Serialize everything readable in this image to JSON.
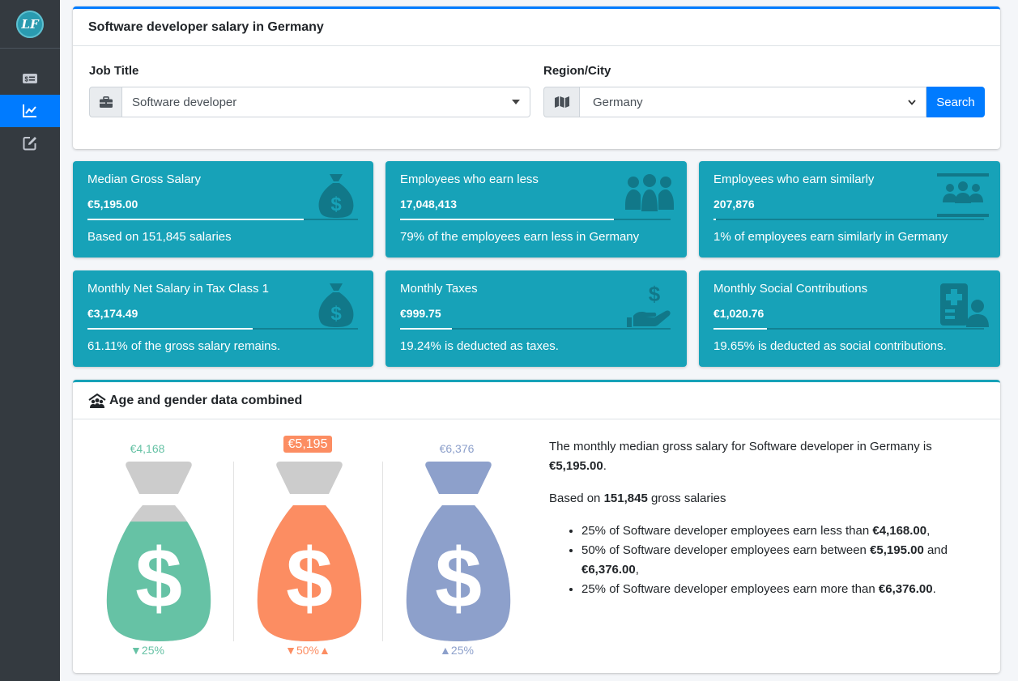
{
  "sidebar": {
    "logo": "LF",
    "items": [
      {
        "icon": "money-bill-icon"
      },
      {
        "icon": "chart-line-icon",
        "active": true
      },
      {
        "icon": "edit-icon"
      }
    ]
  },
  "search": {
    "title": "Software developer salary in Germany",
    "job_label": "Job Title",
    "job_value": "Software developer",
    "region_label": "Region/City",
    "region_value": "Germany",
    "search_button": "Search"
  },
  "info_boxes": [
    {
      "title": "Median Gross Salary",
      "number": "€5,195.00",
      "desc": "Based on 151,845 salaries",
      "progress": 0.8,
      "icon": "money-bag-icon"
    },
    {
      "title": "Employees who earn less",
      "number": "17,048,413",
      "desc": "79% of the employees earn less in Germany",
      "progress": 0.79,
      "icon": "people-group-icon"
    },
    {
      "title": "Employees who earn similarly",
      "number": "207,876",
      "desc": "1% of employees earn similarly in Germany",
      "progress": 0.01,
      "icon": "people-line-icon"
    },
    {
      "title": "Monthly Net Salary in Tax Class 1",
      "number": "€3,174.49",
      "desc": "61.11% of the gross salary remains.",
      "progress": 0.6111,
      "icon": "money-bag-icon"
    },
    {
      "title": "Monthly Taxes",
      "number": "€999.75",
      "desc": "19.24% is deducted as taxes.",
      "progress": 0.1924,
      "icon": "hand-dollar-icon"
    },
    {
      "title": "Monthly Social Contributions",
      "number": "€1,020.76",
      "desc": "19.65% is deducted as social contributions.",
      "progress": 0.1965,
      "icon": "hospital-user-icon"
    }
  ],
  "age_gender": {
    "title": "Age and gender data combined",
    "bags": [
      {
        "value": "€4,168",
        "pct": "▼25%",
        "color": "#66c2a5",
        "fill": 0.88
      },
      {
        "value": "€5,195",
        "pct": "▼50%▲",
        "color": "#fc8d62",
        "fill": 1.0,
        "highlight": true
      },
      {
        "value": "€6,376",
        "pct": "▲25%",
        "color": "#8da0cb",
        "fill": 1.0
      }
    ],
    "desc_line1_pre": "The monthly median gross salary for Software developer in Germany is",
    "desc_line1_bold": "€5,195.00",
    "desc_line1_post": ".",
    "desc_line2_pre": "Based on",
    "desc_line2_bold": "151,845",
    "desc_line2_post": "gross salaries",
    "bullets": [
      {
        "pre": "25% of Software developer employees earn less than",
        "bold": "€4,168.00",
        "post": ","
      },
      {
        "pre": "50% of Software developer employees earn between",
        "bold": "€5,195.00",
        "mid": "and",
        "bold2": "€6,376.00",
        "post": ","
      },
      {
        "pre": "25% of Software developer employees earn more than",
        "bold": "€6,376.00",
        "post": "."
      }
    ]
  }
}
